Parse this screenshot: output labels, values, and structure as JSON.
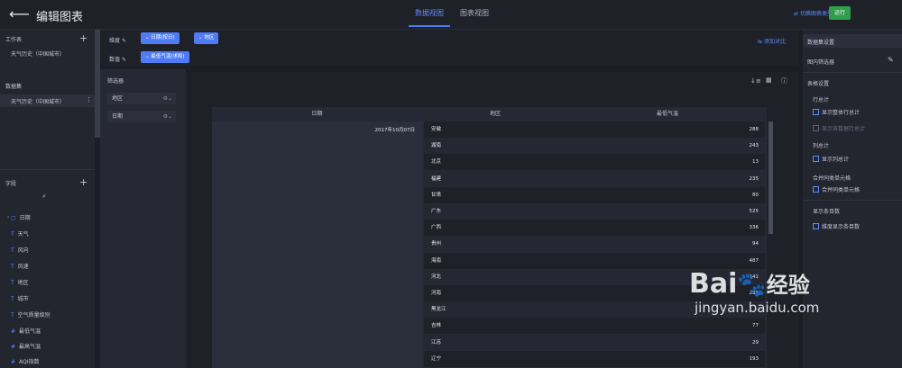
{
  "header": {
    "title": "编辑图表",
    "tabs": [
      "数据视图",
      "图表视图"
    ],
    "switch_label": "切换图表类型",
    "run_label": "运行"
  },
  "left": {
    "worktable_title": "工作表",
    "worktable_item": "天气历史（中国城市）",
    "dataset_title": "数据集",
    "dataset_item": "天气历史（中国城市）",
    "fields_title": "字段",
    "fields": [
      {
        "type": "▢",
        "name": "日期"
      },
      {
        "type": "T",
        "name": "天气"
      },
      {
        "type": "T",
        "name": "风向"
      },
      {
        "type": "T",
        "name": "风速"
      },
      {
        "type": "T",
        "name": "地区"
      },
      {
        "type": "T",
        "name": "城市"
      },
      {
        "type": "T",
        "name": "空气质量级别"
      },
      {
        "type": "#",
        "name": "最低气温"
      },
      {
        "type": "#",
        "name": "最高气温"
      },
      {
        "type": "#",
        "name": "AQI指数"
      }
    ]
  },
  "shelf": {
    "dimension_label": "维度",
    "value_label": "数值",
    "dimension_chips": [
      "日期(按日)",
      "地区"
    ],
    "value_chips": [
      "最低气温(求和)"
    ],
    "compare_label": "添加对比"
  },
  "filters": {
    "title": "筛选器",
    "items": [
      "地区",
      "日期"
    ]
  },
  "table": {
    "headers": [
      "日期",
      "地区",
      "最低气温"
    ],
    "date_value": "2017年10月07日",
    "rows": [
      {
        "region": "安徽",
        "value": "288"
      },
      {
        "region": "湖南",
        "value": "243"
      },
      {
        "region": "北京",
        "value": "13"
      },
      {
        "region": "福建",
        "value": "235"
      },
      {
        "region": "甘肃",
        "value": "80"
      },
      {
        "region": "广东",
        "value": "525"
      },
      {
        "region": "广西",
        "value": "336"
      },
      {
        "region": "贵州",
        "value": "94"
      },
      {
        "region": "海南",
        "value": "487"
      },
      {
        "region": "河北",
        "value": "141"
      },
      {
        "region": "河南",
        "value": "238"
      },
      {
        "region": "黑龙江",
        "value": ""
      },
      {
        "region": "吉林",
        "value": "77"
      },
      {
        "region": "江苏",
        "value": "29"
      },
      {
        "region": "辽宁",
        "value": "193"
      }
    ]
  },
  "right": {
    "title": "数据集设置",
    "in_chart_filter": "图内筛选器",
    "table_settings": "表格设置",
    "row_total": "行总计",
    "show_row_total": "显示整体行总计",
    "show_each_row_total": "显示各数据行总计",
    "col_total": "列总计",
    "show_col_total": "显示列总计",
    "merge_cells": "合并同类单元格",
    "merge_cells_opt": "合并同类单元格",
    "show_count": "显示条目数",
    "dim_show_count": "维度显示条目数"
  },
  "watermark": {
    "brand": "Bai",
    "brand2": "经验",
    "url": "jingyan.baidu.com"
  }
}
